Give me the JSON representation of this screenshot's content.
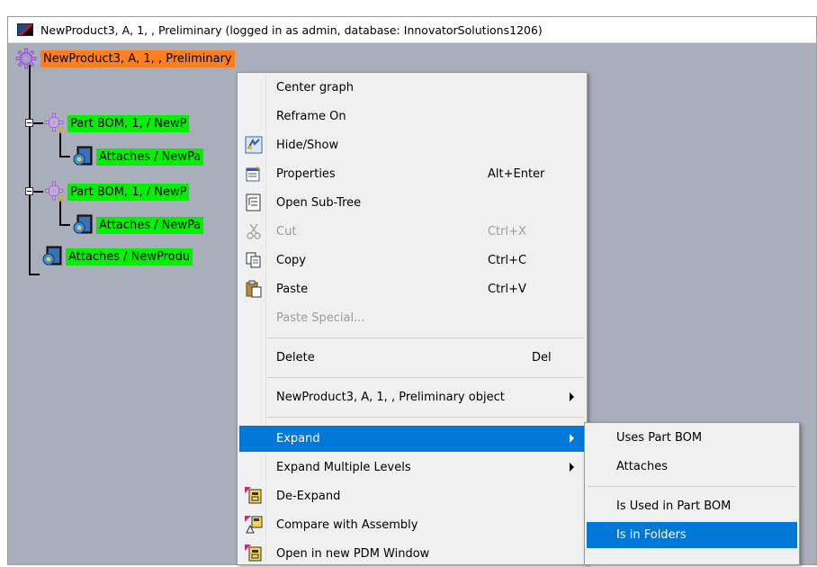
{
  "window": {
    "title": "NewProduct3, A, 1, , Preliminary (logged in as admin, database: InnovatorSolutions1206)"
  },
  "tree": {
    "root": "NewProduct3, A, 1, , Preliminary",
    "nodes": [
      {
        "label": "Part BOM, 1,  / NewP",
        "kind": "part-bom"
      },
      {
        "label": "Attaches / NewPa",
        "kind": "attaches"
      },
      {
        "label": "Part BOM, 1,  / NewP",
        "kind": "part-bom"
      },
      {
        "label": "Attaches / NewPa",
        "kind": "attaches"
      },
      {
        "label": "Attaches / NewProdu",
        "kind": "attaches"
      }
    ]
  },
  "menu": {
    "items": [
      {
        "label": "Center graph",
        "shortcut": "",
        "icon": ""
      },
      {
        "label": "Reframe On",
        "shortcut": "",
        "icon": ""
      },
      {
        "label": "Hide/Show",
        "shortcut": "",
        "icon": "hide-show-icon"
      },
      {
        "label": "Properties",
        "shortcut": "Alt+Enter",
        "icon": "properties-icon"
      },
      {
        "label": "Open Sub-Tree",
        "shortcut": "",
        "icon": "sub-tree-icon"
      },
      {
        "label": "Cut",
        "shortcut": "Ctrl+X",
        "icon": "scissors-icon",
        "disabled": true
      },
      {
        "label": "Copy",
        "shortcut": "Ctrl+C",
        "icon": "copy-icon"
      },
      {
        "label": "Paste",
        "shortcut": "Ctrl+V",
        "icon": "paste-icon"
      },
      {
        "label": "Paste Special...",
        "shortcut": "",
        "icon": "",
        "disabled": true
      },
      {
        "label": "Delete",
        "shortcut": "Del",
        "icon": ""
      },
      {
        "label": "NewProduct3, A, 1, , Preliminary object",
        "shortcut": "",
        "icon": "",
        "submenu": true
      },
      {
        "label": "Expand",
        "shortcut": "",
        "icon": "",
        "submenu": true,
        "highlighted": true
      },
      {
        "label": "Expand Multiple Levels",
        "shortcut": "",
        "icon": "",
        "submenu": true
      },
      {
        "label": "De-Expand",
        "shortcut": "",
        "icon": "de-expand-icon"
      },
      {
        "label": "Compare with Assembly",
        "shortcut": "",
        "icon": "compare-icon"
      },
      {
        "label": "Open in new PDM Window",
        "shortcut": "",
        "icon": "pdm-window-icon"
      }
    ]
  },
  "submenu": {
    "items": [
      {
        "label": "Uses Part BOM"
      },
      {
        "label": "Attaches"
      },
      {
        "label": "Is Used in Part BOM"
      },
      {
        "label": "Is in Folders",
        "highlighted": true
      }
    ]
  },
  "colors": {
    "root_highlight": "#ff7f1e",
    "node_highlight": "#00f000",
    "canvas": "#a8aeba",
    "menu_highlight": "#0078d7"
  }
}
